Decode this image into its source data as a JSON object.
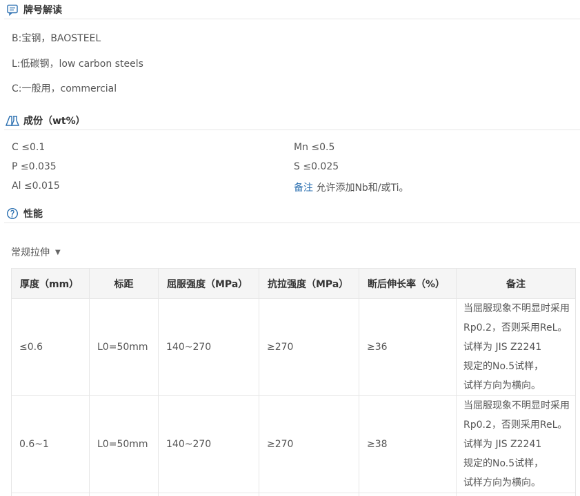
{
  "grade_section": {
    "title": "牌号解读",
    "icon": "message-icon",
    "lines": [
      "B:宝钢，BAOSTEEL",
      "L:低碳钢，low carbon steels",
      "C:一般用，commercial"
    ]
  },
  "composition_section": {
    "title": "成份（wt%）",
    "icon": "flask-icon",
    "items": [
      {
        "key": "C",
        "value": "≤0.1"
      },
      {
        "key": "Mn",
        "value": "≤0.5"
      },
      {
        "key": "P",
        "value": "≤0.035"
      },
      {
        "key": "S",
        "value": "≤0.025"
      },
      {
        "key": "Al",
        "value": "≤0.015"
      },
      {
        "key": "备注",
        "value": "允许添加Nb和/或Ti。"
      }
    ]
  },
  "performance_section": {
    "title": "性能",
    "icon": "info-icon",
    "dropdown_label": "常规拉伸",
    "table": {
      "headers": [
        "厚度（mm）",
        "标距",
        "屈服强度（MPa）",
        "抗拉强度（MPa）",
        "断后伸长率（%）",
        "备注"
      ],
      "rows": [
        {
          "thickness": "≤0.6",
          "gauge": "L0=50mm",
          "yield": "140~270",
          "tensile": "≥270",
          "elongation": "≥36",
          "note": [
            "当屈服现象不明显时采用",
            "Rp0.2，否则采用ReL。",
            "试样为 JIS Z2241",
            "规定的No.5试样，",
            "试样方向为横向。"
          ]
        },
        {
          "thickness": "0.6~1",
          "gauge": "L0=50mm",
          "yield": "140~270",
          "tensile": "≥270",
          "elongation": "≥38",
          "note": [
            "当屈服现象不明显时采用",
            "Rp0.2，否则采用ReL。",
            "试样为 JIS Z2241",
            "规定的No.5试样，",
            "试样方向为横向。"
          ]
        }
      ]
    }
  },
  "colors": {
    "accent": "#2a6fb0",
    "border": "#e6e6e6",
    "header_bg": "#f5f5f5",
    "text": "#555555"
  }
}
